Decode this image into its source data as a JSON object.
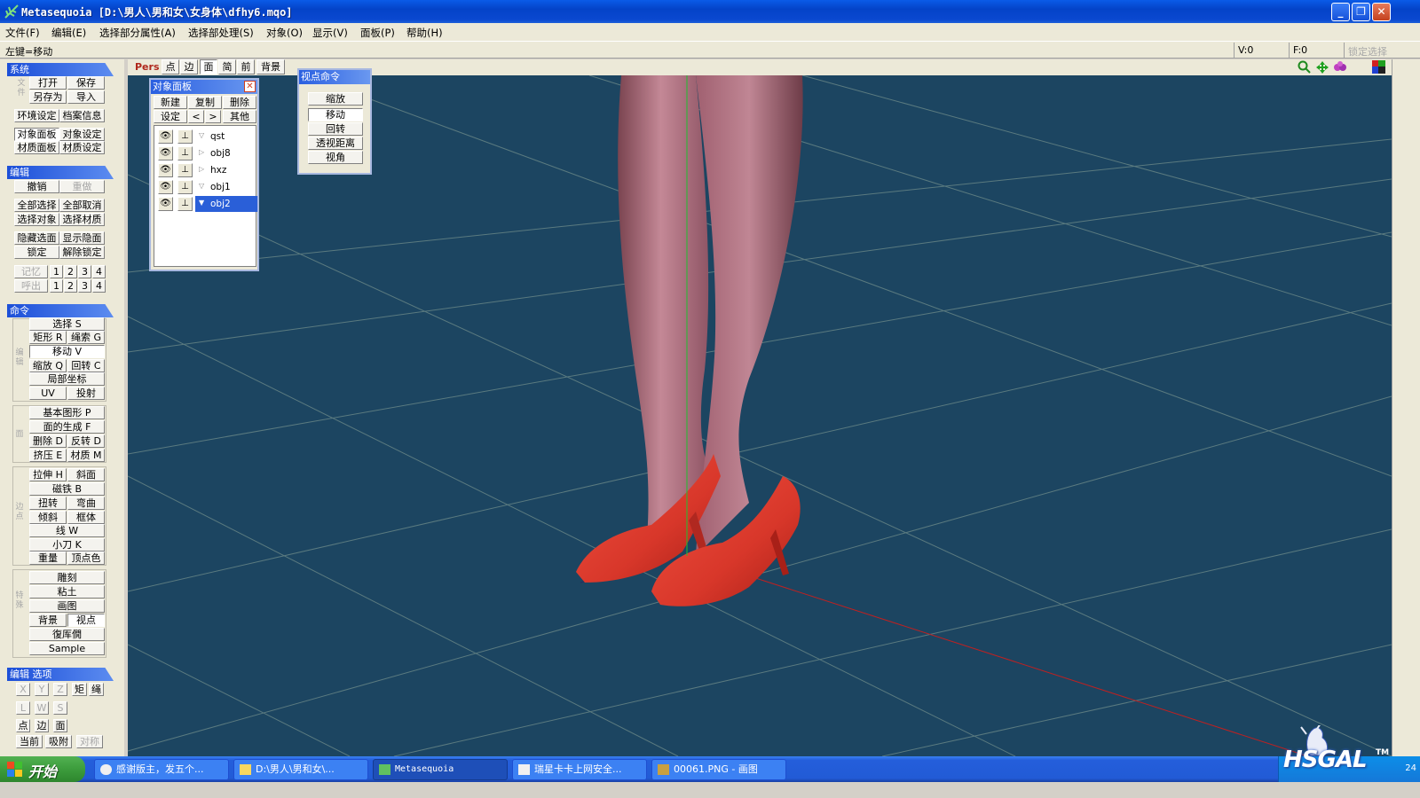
{
  "window": {
    "title": "Metasequoia [D:\\男人\\男和女\\女身体\\dfhy6.mqo]",
    "min": "_",
    "max": "❐",
    "close": "✕"
  },
  "menu": [
    "文件(F)",
    "编辑(E)",
    "选择部分属性(A)",
    "选择部处理(S)",
    "对象(O)",
    "显示(V)",
    "面板(P)",
    "帮助(H)"
  ],
  "status": {
    "left": "左键=移动",
    "v": "V:0",
    "f": "F:0",
    "lock": "锁定选择"
  },
  "left": {
    "system": {
      "header": "系统",
      "side": "文件",
      "open": "打开",
      "save": "保存",
      "saveas": "另存为",
      "import": "导入",
      "env": "环境设定",
      "info": "档案信息",
      "objpanel": "对象面板",
      "objset": "对象设定",
      "matpanel": "材质面板",
      "matset": "材质设定"
    },
    "edit": {
      "header": "编辑",
      "undo": "撤销",
      "redo": "重做",
      "selall": "全部选择",
      "selnone": "全部取消",
      "selobj": "选择对象",
      "selmat": "选择材质",
      "hide": "隐藏选面",
      "show": "显示隐面",
      "lock": "锁定",
      "unlock": "解除锁定",
      "mem": "记忆",
      "recall": "呼出",
      "n1": "1",
      "n2": "2",
      "n3": "3",
      "n4": "4"
    },
    "command": {
      "header": "命令",
      "side1": "编辑",
      "side2": "面",
      "side3": "边点",
      "side4": "特殊",
      "select": "选择 S",
      "rect": "矩形 R",
      "lasso": "绳索 G",
      "move": "移动 V",
      "scale": "缩放 Q",
      "rotate": "回转 C",
      "local": "局部坐标",
      "uv": "UV",
      "proj": "投射",
      "prim": "基本图形 P",
      "face": "面的生成 F",
      "del": "删除 D",
      "flip": "反转 D",
      "extrude": "挤压 E",
      "mat": "材质 M",
      "stretch": "拉伸 H",
      "bevel": "斜面",
      "magnet": "磁铁 B",
      "twist": "扭转",
      "bend": "弯曲",
      "tilt": "倾斜",
      "lattice": "框体",
      "line": "线 W",
      "knife": "小刀 K",
      "weight": "重量",
      "vcolor": "顶点色",
      "sculpt": "雕刻",
      "clay": "粘土",
      "paint": "画图",
      "bg": "背景",
      "view": "视点",
      "rebuild": "復厍僩",
      "sample": "Sample"
    },
    "editopt": {
      "header": "编辑 选项",
      "x": "X",
      "y": "Y",
      "z": "Z",
      "rect": "矩",
      "lasso": "绳",
      "l": "L",
      "w": "W",
      "s": "S",
      "pt": "点",
      "edge": "边",
      "face": "面",
      "cur": "当前",
      "snap": "吸附",
      "sym": "对称"
    }
  },
  "viewtoolbar": {
    "pers": "Pers",
    "pt": "点",
    "edge": "边",
    "face": "面",
    "simple": "简",
    "front": "前",
    "bg": "背景"
  },
  "objpanel": {
    "title": "对象面板",
    "new": "新建",
    "copy": "复制",
    "del": "删除",
    "set": "设定",
    "prev": "<",
    "next": ">",
    "other": "其他",
    "objects": [
      "qst",
      "obj8",
      "hxz",
      "obj1",
      "obj2"
    ]
  },
  "viewcmd": {
    "title": "视点命令",
    "zoom": "缩放",
    "move": "移动",
    "rotate": "回转",
    "persp": "透视距离",
    "angle": "视角"
  },
  "taskbar": {
    "start": "开始",
    "tasks": [
      "感谢版主，发五个...",
      "D:\\男人\\男和女\\...",
      "Metasequoia",
      "瑞星卡卡上网安全...",
      "00061.PNG - 画图"
    ],
    "clock": "24"
  },
  "watermark": {
    "text": "HSGAL",
    "tm": "TM"
  },
  "colors": {
    "viewport": "#1c4561",
    "titlebar": "#0a48d0",
    "selection": "#2a5fd8"
  }
}
